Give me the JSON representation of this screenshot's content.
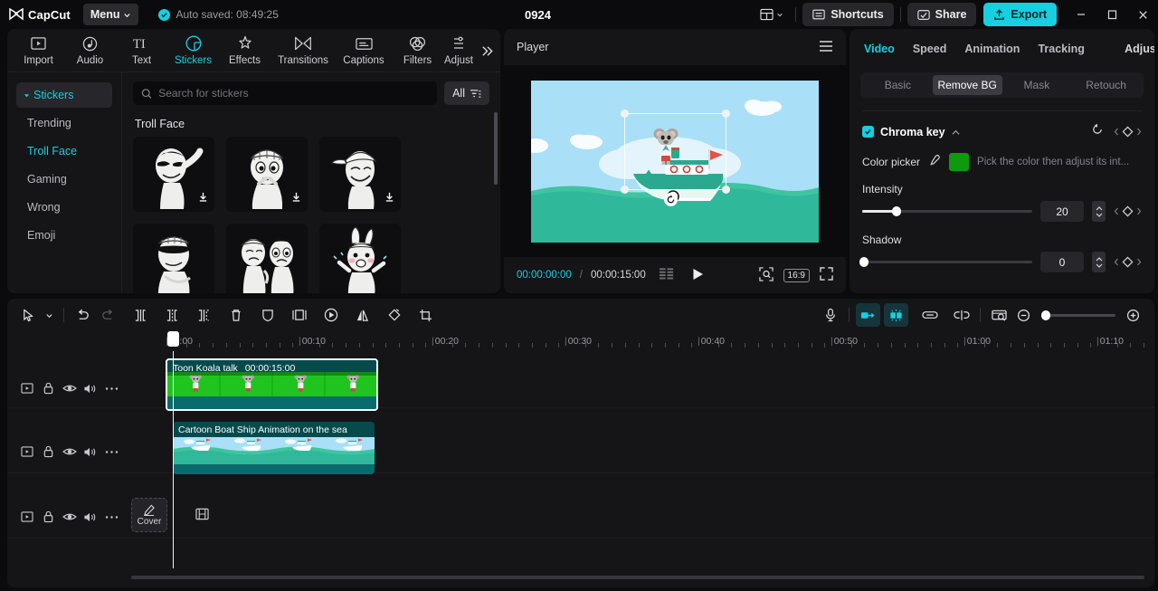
{
  "titlebar": {
    "brand": "CapCut",
    "menu_label": "Menu",
    "autosave_text": "Auto saved: 08:49:25",
    "project_title": "0924",
    "shortcuts_label": "Shortcuts",
    "share_label": "Share",
    "export_label": "Export",
    "accent": "#16cfe0"
  },
  "tooltabs": [
    {
      "label": "Import",
      "icon": "import-icon",
      "active": false
    },
    {
      "label": "Audio",
      "icon": "audio-icon",
      "active": false
    },
    {
      "label": "Text",
      "icon": "text-icon",
      "active": false
    },
    {
      "label": "Stickers",
      "icon": "stickers-icon",
      "active": true
    },
    {
      "label": "Effects",
      "icon": "effects-icon",
      "active": false
    },
    {
      "label": "Transitions",
      "icon": "transitions-icon",
      "active": false
    },
    {
      "label": "Captions",
      "icon": "captions-icon",
      "active": false
    },
    {
      "label": "Filters",
      "icon": "filters-icon",
      "active": false
    },
    {
      "label": "Adjust",
      "icon": "adjust-icon",
      "active": false
    }
  ],
  "stickers": {
    "categories": [
      {
        "label": "Stickers",
        "header": true,
        "active": false
      },
      {
        "label": "Trending",
        "header": false,
        "active": false
      },
      {
        "label": "Troll Face",
        "header": false,
        "active": true
      },
      {
        "label": "Gaming",
        "header": false,
        "active": false
      },
      {
        "label": "Wrong",
        "header": false,
        "active": false
      },
      {
        "label": "Emoji",
        "header": false,
        "active": false
      }
    ],
    "search_placeholder": "Search for stickers",
    "search_value": "",
    "filter_label": "All",
    "section_title": "Troll Face",
    "items": [
      {
        "name": "troll-sunglasses-salute",
        "downloadable": true
      },
      {
        "name": "troll-beanie-thinking",
        "downloadable": true
      },
      {
        "name": "troll-cap-grin",
        "downloadable": true
      },
      {
        "name": "troll-cap-sunglasses",
        "downloadable": false
      },
      {
        "name": "troll-pair-sad",
        "downloadable": false
      },
      {
        "name": "troll-bunny-cheer",
        "downloadable": false
      }
    ]
  },
  "player": {
    "title": "Player",
    "current_time": "00:00:00:00",
    "separator": "/",
    "total_time": "00:00:15:00",
    "ratio_label": "16:9"
  },
  "properties": {
    "tabs": [
      {
        "label": "Video",
        "active": true
      },
      {
        "label": "Speed",
        "active": false
      },
      {
        "label": "Animation",
        "active": false
      },
      {
        "label": "Tracking",
        "active": false
      },
      {
        "label": "Adjust",
        "active": false
      }
    ],
    "segments": [
      {
        "label": "Basic",
        "active": false
      },
      {
        "label": "Remove BG",
        "active": true
      },
      {
        "label": "Mask",
        "active": false
      },
      {
        "label": "Retouch",
        "active": false
      }
    ],
    "chroma": {
      "title": "Chroma key",
      "enabled": true,
      "color_picker_label": "Color picker",
      "swatch_color": "#0d9a0d",
      "hint": "Pick the color then adjust its int...",
      "intensity_label": "Intensity",
      "intensity_value": "20",
      "shadow_label": "Shadow",
      "shadow_value": "0"
    }
  },
  "timeline": {
    "tools": [
      {
        "name": "select-tool-icon",
        "state": "normal"
      },
      {
        "name": "select-dropdown-icon",
        "state": "normal"
      },
      {
        "name": "undo-icon",
        "state": "normal"
      },
      {
        "name": "redo-icon",
        "state": "dim"
      },
      {
        "name": "split-icon",
        "state": "normal"
      },
      {
        "name": "split-left-icon",
        "state": "normal"
      },
      {
        "name": "split-right-icon",
        "state": "normal"
      },
      {
        "name": "delete-icon",
        "state": "normal"
      },
      {
        "name": "freeze-icon",
        "state": "normal"
      },
      {
        "name": "mirror-icon",
        "state": "normal"
      },
      {
        "name": "speed-icon",
        "state": "normal"
      },
      {
        "name": "flip-icon",
        "state": "normal"
      },
      {
        "name": "rotate-icon",
        "state": "normal"
      },
      {
        "name": "crop-icon",
        "state": "normal"
      }
    ],
    "right_tools": [
      {
        "name": "microphone-icon",
        "state": "normal"
      },
      {
        "name": "magnet-snap-icon",
        "state": "active"
      },
      {
        "name": "auto-arrange-icon",
        "state": "active"
      },
      {
        "name": "link-icon",
        "state": "normal"
      },
      {
        "name": "unlink-icon",
        "state": "normal"
      },
      {
        "name": "preview-frames-icon",
        "state": "normal"
      },
      {
        "name": "zoom-out-icon",
        "state": "normal"
      },
      {
        "name": "zoom-in-icon",
        "state": "normal"
      }
    ],
    "ruler_labels": [
      "00:00",
      "00:10",
      "00:20",
      "00:30",
      "00:40",
      "00:50",
      "01:00",
      "01:10"
    ],
    "clips": [
      {
        "title": "Toon Koala talk",
        "duration": "00:00:15:00",
        "selected": true,
        "type": "green-screen"
      },
      {
        "title": "Cartoon Boat Ship Animation on the sea",
        "duration": "",
        "selected": false,
        "type": "sea"
      }
    ],
    "cover_label": "Cover",
    "track_controls": [
      "video-track-icon",
      "lock-icon",
      "eye-icon",
      "volume-icon",
      "more-icon"
    ]
  }
}
